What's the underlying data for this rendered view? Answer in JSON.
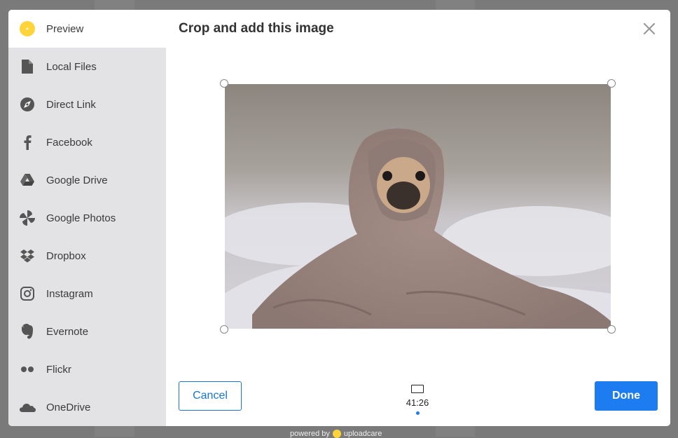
{
  "dialog": {
    "title": "Crop and add this image",
    "close_icon": "close-icon"
  },
  "sidebar": {
    "items": [
      {
        "label": "Preview",
        "icon": "preview-dot-icon",
        "active": true
      },
      {
        "label": "Local Files",
        "icon": "file-icon"
      },
      {
        "label": "Direct Link",
        "icon": "compass-icon"
      },
      {
        "label": "Facebook",
        "icon": "facebook-icon"
      },
      {
        "label": "Google Drive",
        "icon": "google-drive-icon"
      },
      {
        "label": "Google Photos",
        "icon": "pinwheel-icon"
      },
      {
        "label": "Dropbox",
        "icon": "dropbox-icon"
      },
      {
        "label": "Instagram",
        "icon": "instagram-icon"
      },
      {
        "label": "Evernote",
        "icon": "evernote-icon"
      },
      {
        "label": "Flickr",
        "icon": "flickr-icon"
      },
      {
        "label": "OneDrive",
        "icon": "cloud-icon"
      }
    ]
  },
  "footer": {
    "cancel_label": "Cancel",
    "done_label": "Done",
    "ratio_label": "41:26"
  },
  "powered": {
    "prefix": "powered by",
    "brand": "uploadcare"
  },
  "colors": {
    "accent": "#1c7cf0",
    "sidebar_bg": "#e3e2e4",
    "preview_icon": "#ffd43b",
    "overlay": "#7a7a7a"
  }
}
